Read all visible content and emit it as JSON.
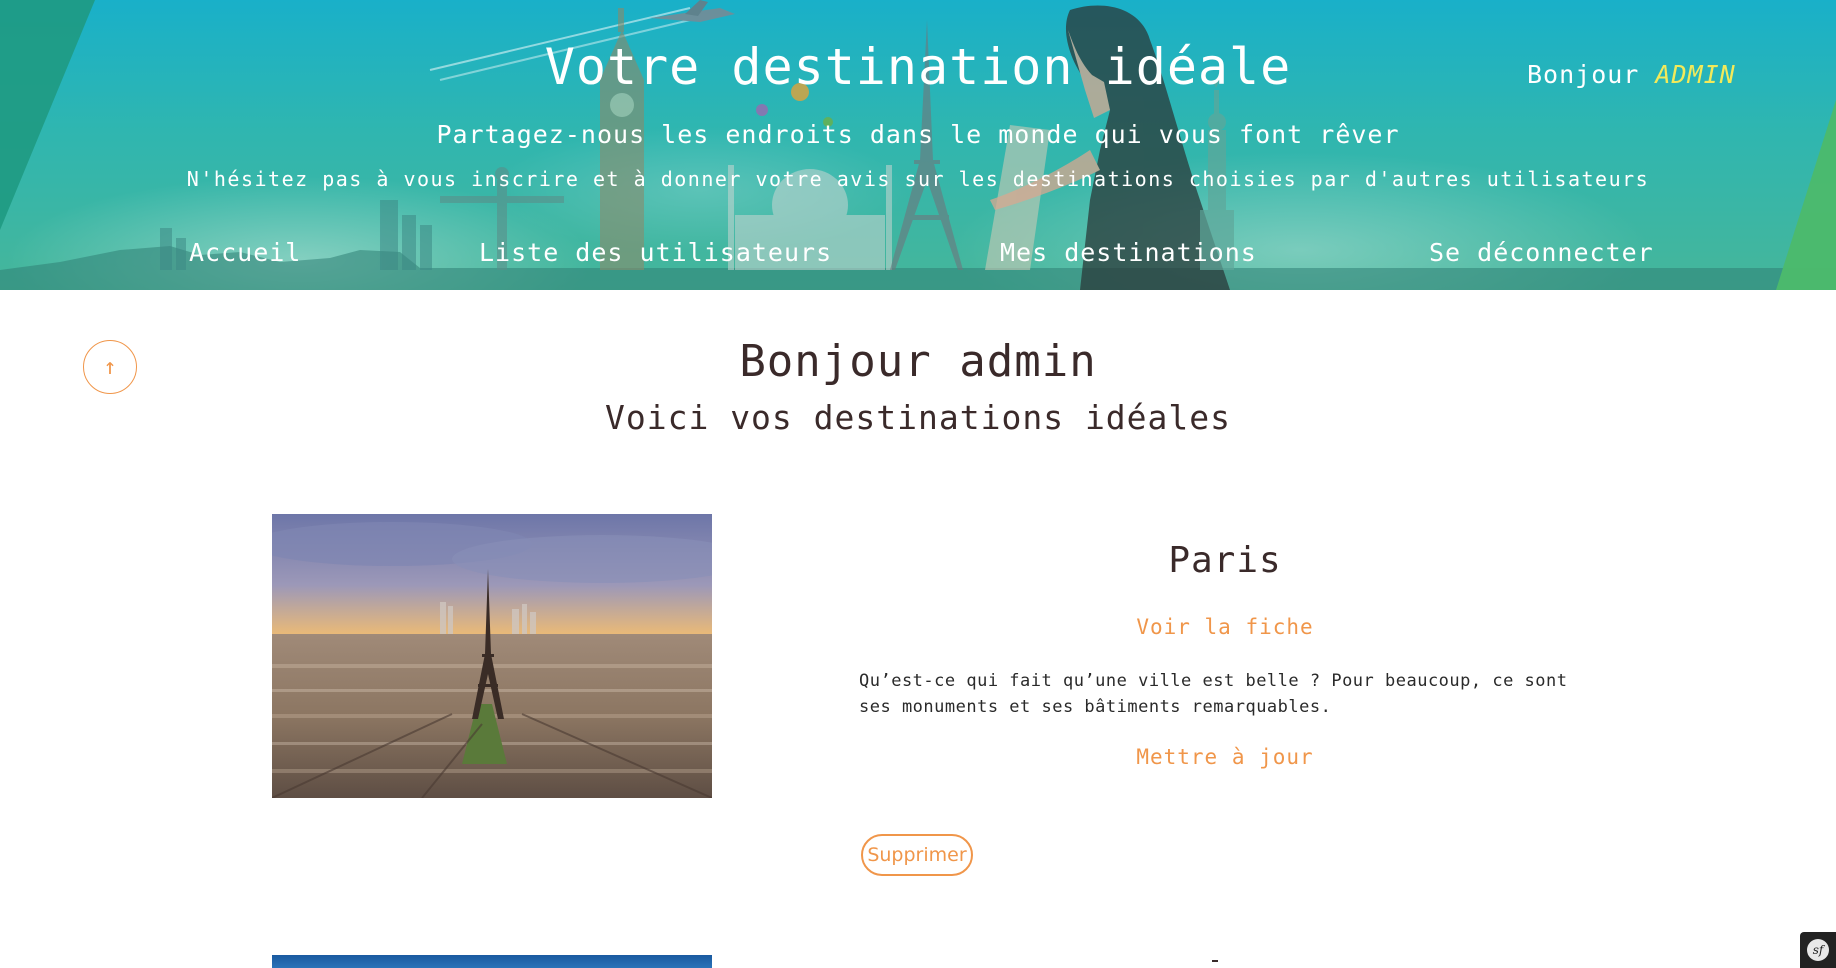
{
  "header": {
    "title": "Votre destination idéale",
    "greeting_prefix": "Bonjour",
    "greeting_user": "ADMIN",
    "subtitle": "Partagez-nous les endroits dans le monde qui vous font rêver",
    "tagline": "N'hésitez pas à vous inscrire et à donner votre avis sur les destinations choisies par d'autres utilisateurs"
  },
  "nav": {
    "items": [
      {
        "label": "Accueil"
      },
      {
        "label": "Liste des utilisateurs"
      },
      {
        "label": "Mes destinations"
      },
      {
        "label": "Se déconnecter"
      }
    ]
  },
  "main": {
    "scroll_top_icon": "arrow-up-icon",
    "scroll_top_glyph": "↑",
    "title": "Bonjour admin",
    "subtitle": "Voici vos destinations idéales",
    "destinations": [
      {
        "name": "Paris",
        "view_label": "Voir la fiche",
        "description": "Qu’est-ce qui fait qu’une ville est belle ? Pour beaucoup, ce sont ses monuments et ses bâtiments remarquables.",
        "update_label": "Mettre à jour",
        "delete_label": "Supprimer"
      }
    ]
  },
  "colors": {
    "accent": "#f0964a",
    "header_teal": "#19b0c9",
    "header_green": "#4cbb6b",
    "greeting_user": "#f2ea5a",
    "text": "#3a2a2a"
  },
  "debug_toolbar": {
    "icon": "symfony-icon",
    "glyph": "sf"
  }
}
